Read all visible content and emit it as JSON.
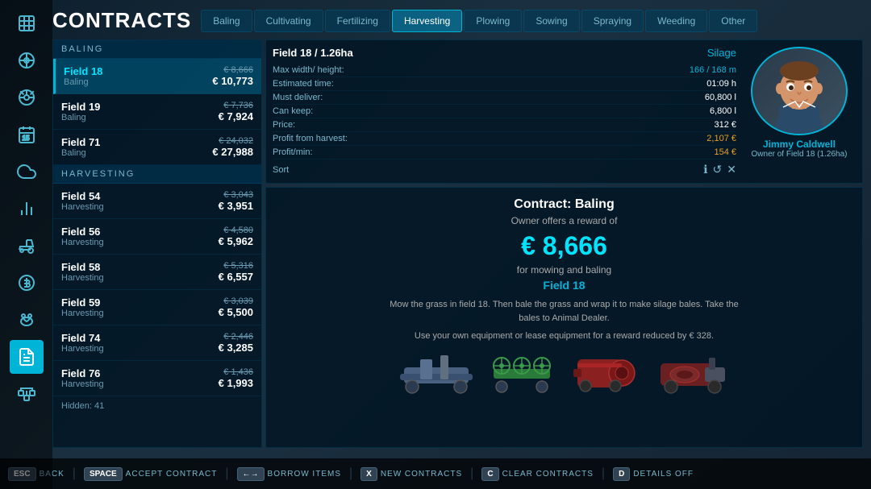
{
  "header": {
    "title": "CONTRACTS"
  },
  "tabs": [
    {
      "id": "baling",
      "label": "Baling",
      "active": false
    },
    {
      "id": "cultivating",
      "label": "Cultivating",
      "active": false
    },
    {
      "id": "fertilizing",
      "label": "Fertilizing",
      "active": false
    },
    {
      "id": "harvesting",
      "label": "Harvesting",
      "active": true
    },
    {
      "id": "plowing",
      "label": "Plowing",
      "active": false
    },
    {
      "id": "sowing",
      "label": "Sowing",
      "active": false
    },
    {
      "id": "spraying",
      "label": "Spraying",
      "active": false
    },
    {
      "id": "weeding",
      "label": "Weeding",
      "active": false
    },
    {
      "id": "other",
      "label": "Other",
      "active": false
    }
  ],
  "baling_section": {
    "header": "BALING",
    "items": [
      {
        "field": "Field 18",
        "type": "Baling",
        "price_old": "€ 8,666",
        "price_new": "€ 10,773",
        "selected": true
      },
      {
        "field": "Field 19",
        "type": "Baling",
        "price_old": "€ 7,736",
        "price_new": "€ 7,924",
        "selected": false
      },
      {
        "field": "Field 71",
        "type": "Baling",
        "price_old": "€ 24,032",
        "price_new": "€ 27,988",
        "selected": false
      }
    ]
  },
  "harvesting_section": {
    "header": "HARVESTING",
    "items": [
      {
        "field": "Field 54",
        "type": "Harvesting",
        "price_old": "€ 3,043",
        "price_new": "€ 3,951",
        "selected": false
      },
      {
        "field": "Field 56",
        "type": "Harvesting",
        "price_old": "€ 4,580",
        "price_new": "€ 5,962",
        "selected": false
      },
      {
        "field": "Field 58",
        "type": "Harvesting",
        "price_old": "€ 5,316",
        "price_new": "€ 6,557",
        "selected": false
      },
      {
        "field": "Field 59",
        "type": "Harvesting",
        "price_old": "€ 3,039",
        "price_new": "€ 5,500",
        "selected": false
      },
      {
        "field": "Field 74",
        "type": "Harvesting",
        "price_old": "€ 2,446",
        "price_new": "€ 3,285",
        "selected": false
      },
      {
        "field": "Field 76",
        "type": "Harvesting",
        "price_old": "€ 1,436",
        "price_new": "€ 1,993",
        "selected": false
      }
    ]
  },
  "hidden_count": "Hidden: 41",
  "detail": {
    "field_info": "Field 18 / 1.26ha",
    "type": "Silage",
    "max_width": "166 / 168 m",
    "estimated_time": "01:09 h",
    "must_deliver": "60,800 l",
    "can_keep": "6,800 l",
    "price": "312 €",
    "profit_from_harvest": "2,107 €",
    "profit_min": "154 €",
    "sort_label": "Sort"
  },
  "farmer": {
    "name": "Jimmy Caldwell",
    "role": "Owner of Field 18 (1.26ha)"
  },
  "contract_info": {
    "title": "Contract: Baling",
    "subtitle": "Owner offers a reward of",
    "big_price": "€ 8,666",
    "for_text": "for mowing and baling",
    "field_name": "Field 18",
    "description": "Mow the grass in field 18. Then bale the grass and wrap it to make silage bales. Take the bales to Animal Dealer.",
    "lease_text": "Use your own equipment or lease equipment for a reward reduced by € 328."
  },
  "bottom_bar": [
    {
      "key": "ESC",
      "action": "BACK"
    },
    {
      "key": "SPACE",
      "action": "ACCEPT CONTRACT"
    },
    {
      "key": "←→",
      "action": "BORROW ITEMS"
    },
    {
      "key": "X",
      "action": "NEW CONTRACTS"
    },
    {
      "key": "C",
      "action": "CLEAR CONTRACTS"
    },
    {
      "key": "D",
      "action": "DETAILS OFF"
    }
  ],
  "colors": {
    "accent": "#00b4d8",
    "bg_dark": "#0d1f2d",
    "text_muted": "#7ab8cc"
  }
}
